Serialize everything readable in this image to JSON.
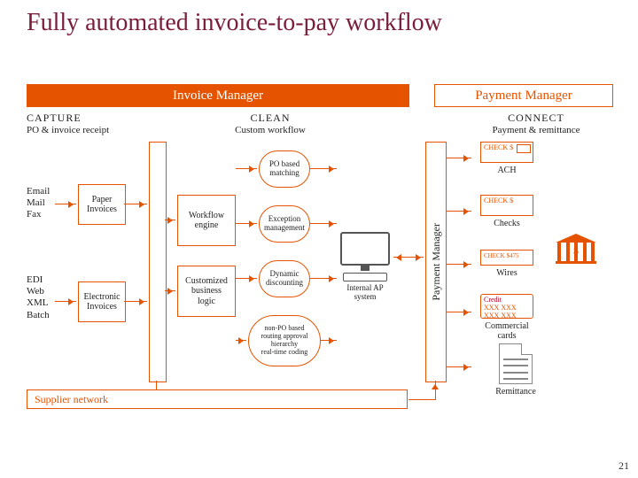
{
  "title": "Fully automated invoice-to-pay workflow",
  "page_number": "21",
  "sections": {
    "invoice_manager": "Invoice Manager",
    "payment_manager": "Payment Manager"
  },
  "columns": {
    "capture": {
      "title": "CAPTURE",
      "subtitle": "PO & invoice receipt"
    },
    "clean": {
      "title": "CLEAN",
      "subtitle": "Custom workflow"
    },
    "connect": {
      "title": "CONNECT",
      "subtitle": "Payment & remittance"
    }
  },
  "capture": {
    "group1_label": "Email\nMail\nFax",
    "group1_box": "Paper\nInvoices",
    "group2_label": "EDI\nWeb\nXML\nBatch",
    "group2_box": "Electronic\nInvoices"
  },
  "clean": {
    "workflow_engine": "Workflow\nengine",
    "custom_logic": "Customized\nbusiness\nlogic",
    "nodes": {
      "po_match": "PO based\nmatching",
      "exception": "Exception\nmanagement",
      "discount": "Dynamic\ndiscounting",
      "nonpo": "non-PO based\nrouting approval\nhierarchy\nreal-time coding"
    }
  },
  "ap_system": "Internal AP\nsystem",
  "payment_bar": "Payment Manager",
  "connect": {
    "ach": "ACH",
    "checks": "Checks",
    "wires": "Wires",
    "cards": "Commercial cards",
    "remittance": "Remittance",
    "cheque_label_top": "CHECK $",
    "cheque_label_mid": "CHECK $",
    "cheque_small": "CHECK $475",
    "card_label": "Credit",
    "card_digits": "XXX XXX XXX XXX"
  },
  "supplier_network": "Supplier network"
}
